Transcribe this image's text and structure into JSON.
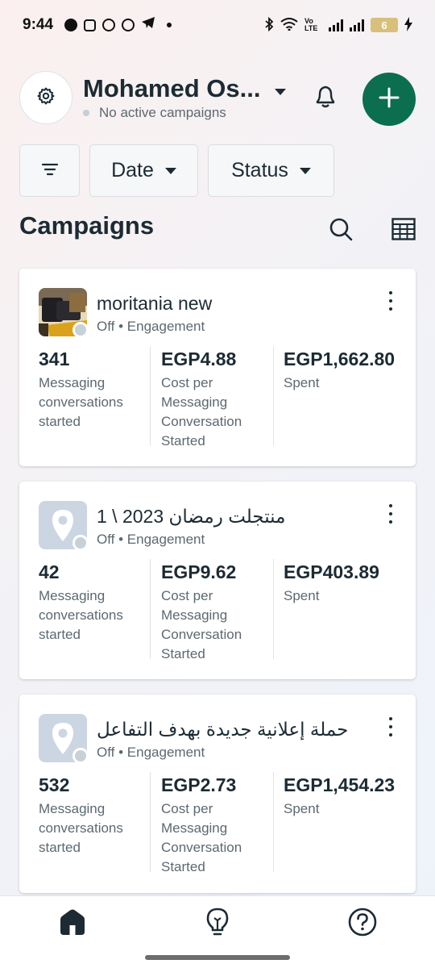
{
  "status_bar": {
    "time": "9:44",
    "volte": "Vo LTE",
    "battery": "6"
  },
  "header": {
    "account_name": "Mohamed Os...",
    "account_status": "No active campaigns"
  },
  "filters": {
    "date_label": "Date",
    "status_label": "Status"
  },
  "section_title": "Campaigns",
  "campaigns": [
    {
      "name": "moritania new",
      "status": "Off",
      "objective": "Engagement",
      "results_value": "341",
      "results_label": "Messaging conversations started",
      "cost_value": "EGP4.88",
      "cost_label": "Cost per Messaging Conversation Started",
      "spent_value": "EGP1,662.80",
      "spent_label": "Spent"
    },
    {
      "name": "منتجلت رمضان 2023 \\ 1",
      "status": "Off",
      "objective": "Engagement",
      "results_value": "42",
      "results_label": "Messaging conversations started",
      "cost_value": "EGP9.62",
      "cost_label": "Cost per Messaging Conversation Started",
      "spent_value": "EGP403.89",
      "spent_label": "Spent"
    },
    {
      "name": "حملة إعلانية جديدة بهدف التفاعل",
      "status": "Off",
      "objective": "Engagement",
      "results_value": "532",
      "results_label": "Messaging conversations started",
      "cost_value": "EGP2.73",
      "cost_label": "Cost per Messaging Conversation Started",
      "spent_value": "EGP1,454.23",
      "spent_label": "Spent"
    }
  ],
  "colors": {
    "accent_green": "#0b6e4f",
    "text_primary": "#1c2b33",
    "text_secondary": "#5c6970"
  },
  "icons": {
    "header": [
      "gear-icon",
      "caret-down-icon",
      "bell-icon",
      "plus-icon"
    ],
    "filters": [
      "filter-icon"
    ],
    "section": [
      "search-icon",
      "table-icon"
    ],
    "nav": [
      "home-icon",
      "lightbulb-icon",
      "help-icon"
    ]
  }
}
